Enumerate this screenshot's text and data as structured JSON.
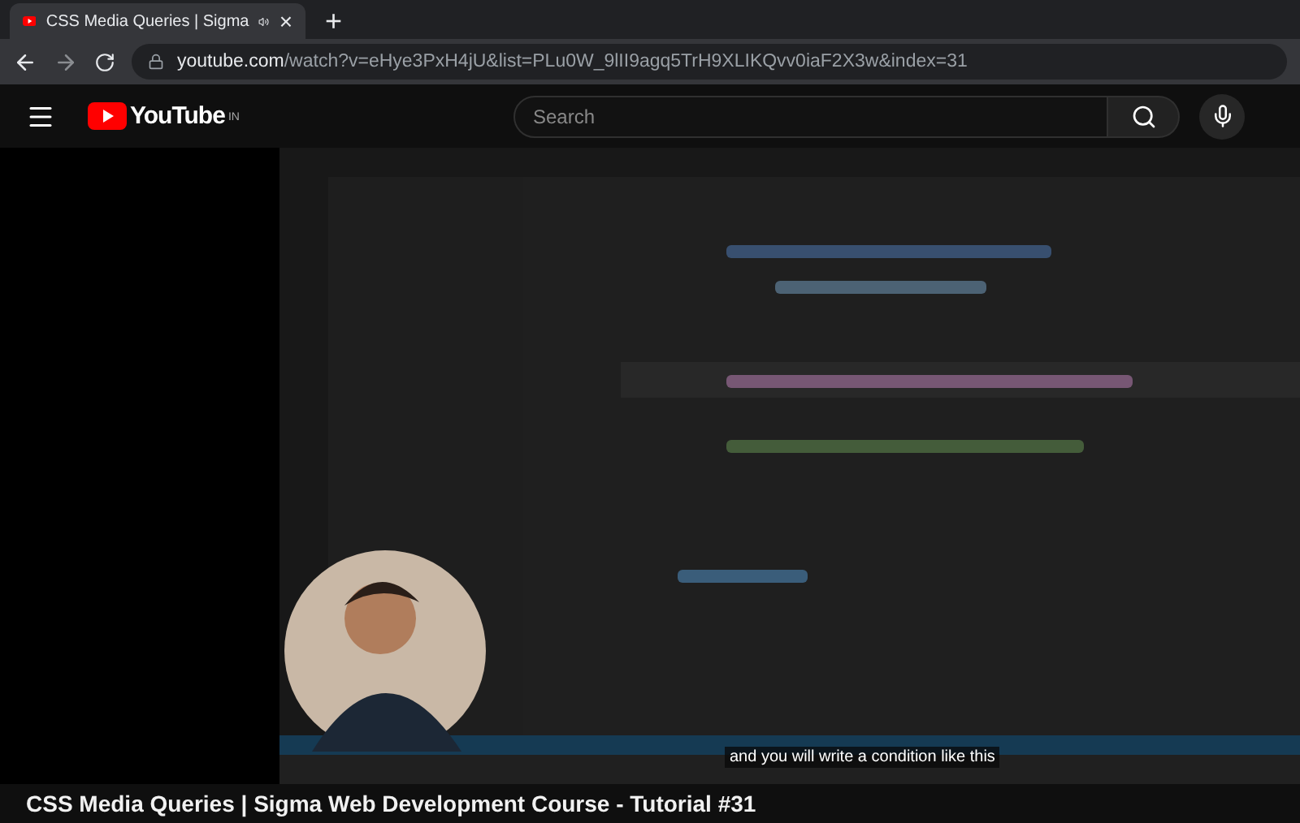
{
  "browser": {
    "tab": {
      "title": "CSS Media Queries | Sigma",
      "close": "×"
    },
    "new_tab": "+",
    "url": {
      "host": "youtube.com",
      "path": "/watch?v=eHye3PxH4jU&list=PLu0W_9lII9agq5TrH9XLIKQvv0iaF2X3w&index=31"
    }
  },
  "header": {
    "logo": "YouTube",
    "region": "IN",
    "search": {
      "placeholder": "Search"
    }
  },
  "player": {
    "caption": "and you will write a condition like this"
  },
  "video_title": "CSS Media Queries | Sigma Web Development Course - Tutorial #31"
}
